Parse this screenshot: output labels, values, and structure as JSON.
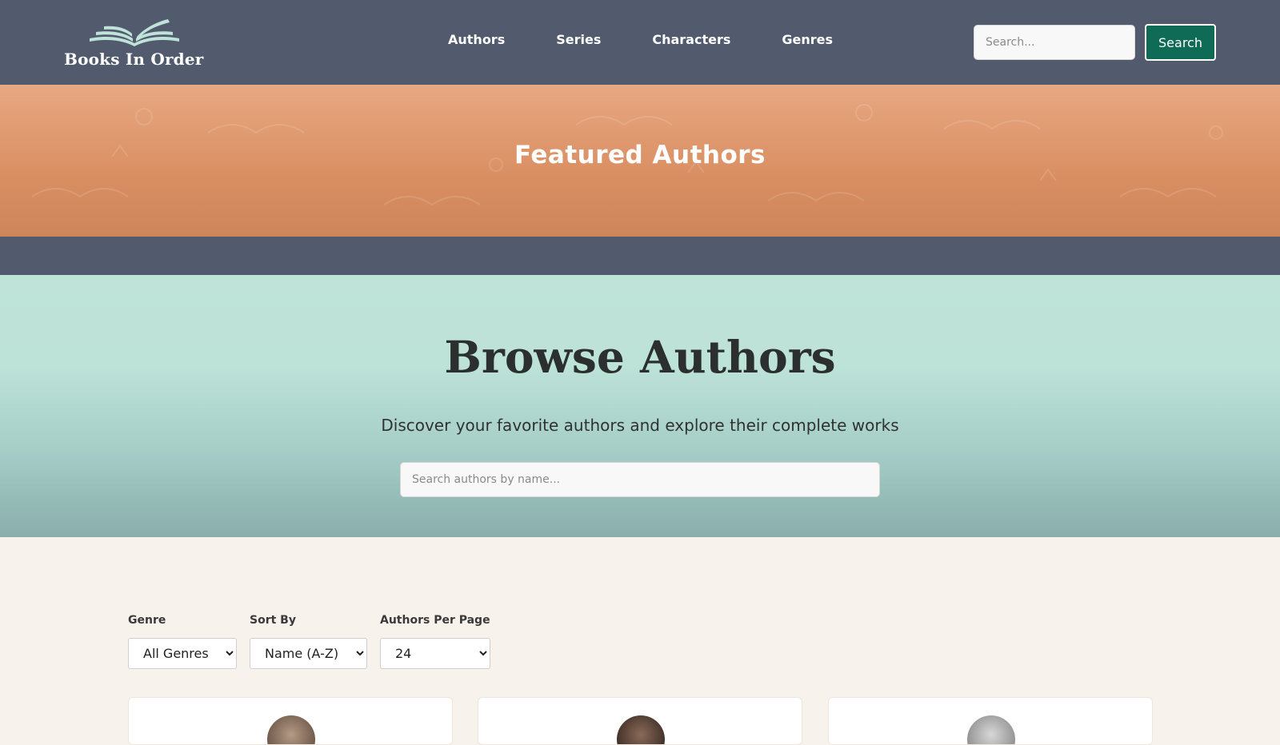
{
  "brand": {
    "name": "Books In Order",
    "logo_icon": "open-book-icon"
  },
  "nav": {
    "links": [
      {
        "label": "Authors"
      },
      {
        "label": "Series"
      },
      {
        "label": "Characters"
      },
      {
        "label": "Genres"
      }
    ],
    "search_placeholder": "Search...",
    "search_button": "Search"
  },
  "featured": {
    "title": "Featured Authors"
  },
  "browse": {
    "title": "Browse Authors",
    "subtitle": "Discover your favorite authors and explore their complete works",
    "search_placeholder": "Search authors by name..."
  },
  "filters": {
    "genre": {
      "label": "Genre",
      "selected": "All Genres"
    },
    "sort": {
      "label": "Sort By",
      "selected": "Name (A-Z)"
    },
    "per_page": {
      "label": "Authors Per Page",
      "selected": "24"
    }
  },
  "colors": {
    "nav_bg": "#525a6e",
    "featured_bg": "#df9a70",
    "browse_bg": "#bde2d8",
    "accent_button": "#0f6b55",
    "page_bg": "#f7f2ec"
  }
}
